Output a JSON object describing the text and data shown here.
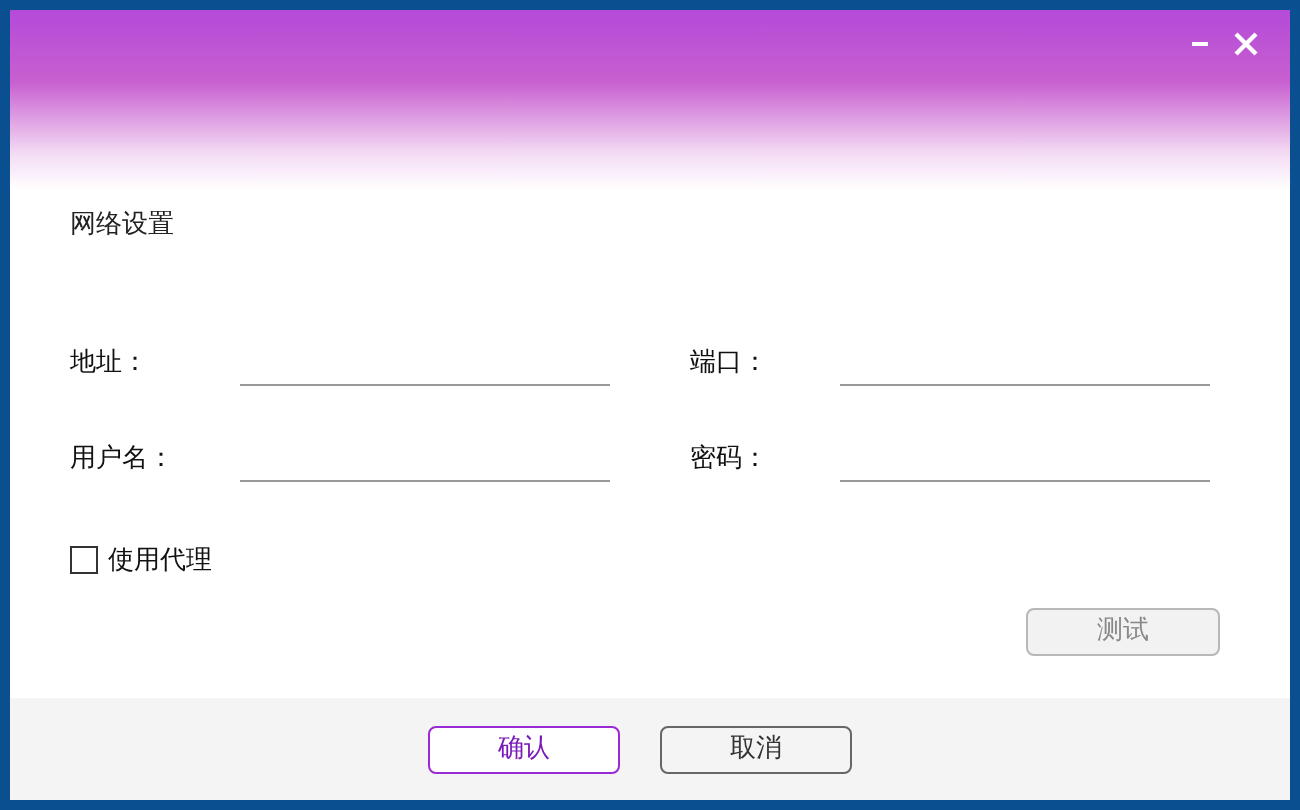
{
  "window": {
    "controls": [
      {
        "kind": "minimize"
      },
      {
        "kind": "close"
      }
    ]
  },
  "section_title": "网络设置",
  "fields": [
    {
      "label": "地址："
    },
    {
      "label": "端口："
    },
    {
      "label": "用户名："
    },
    {
      "label": "密码："
    }
  ],
  "proxy": {
    "label": "使用代理",
    "checked": false
  },
  "test_button": {
    "label": "测试",
    "disabled": true
  },
  "buttons": [
    {
      "label": "确认",
      "kind": "primary"
    },
    {
      "label": "取消",
      "kind": "default"
    }
  ]
}
